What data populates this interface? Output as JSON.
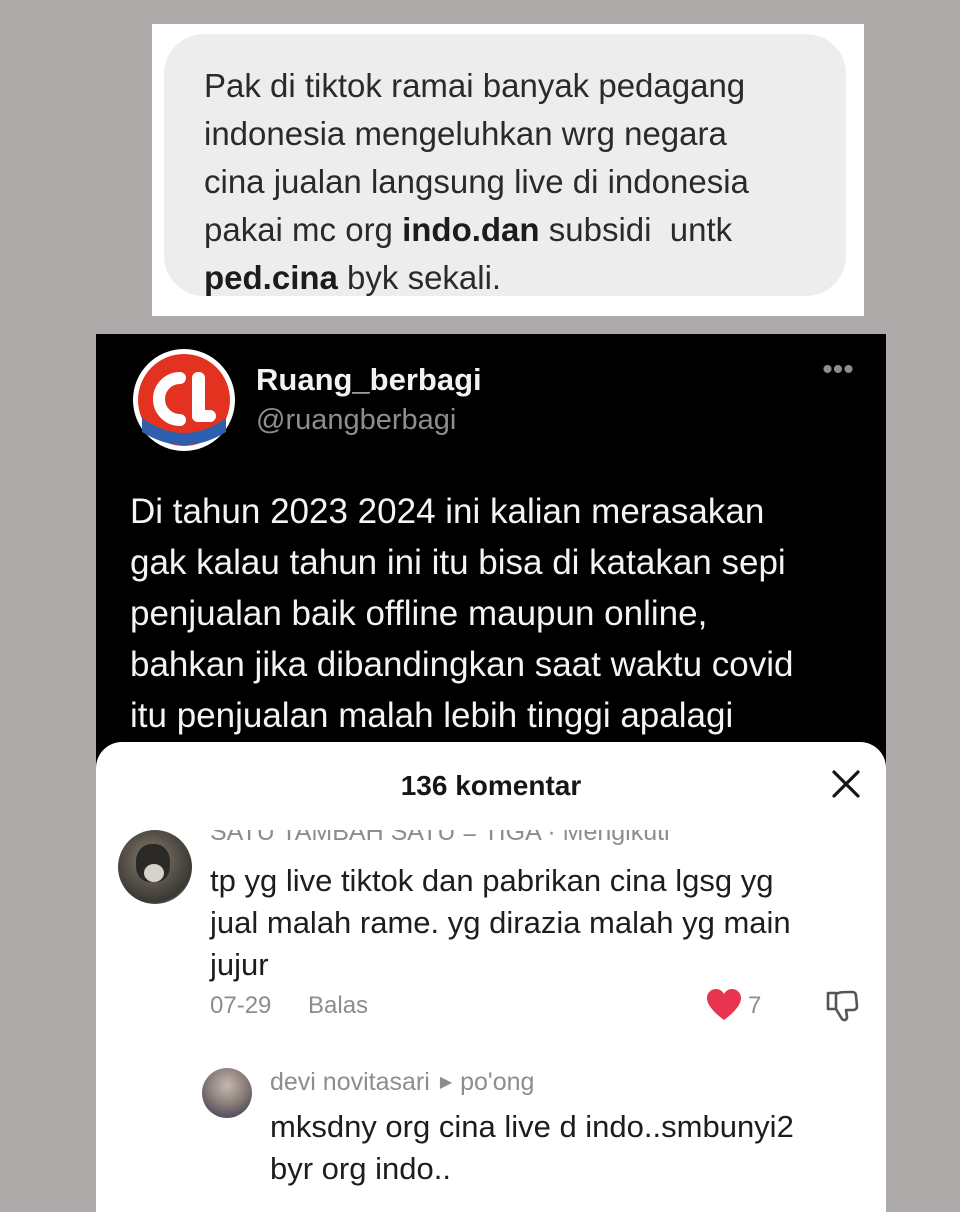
{
  "chat": {
    "line1": "Pak di tiktok ramai banyak pedagang",
    "line2": "indonesia mengeluhkan wrg negara",
    "line3": "cina jualan langsung live di indonesia",
    "line4_a": "pakai mc org ",
    "line4_b": "indo.dan",
    "line4_c": " subsidi  untk",
    "line5_a": "ped.cina",
    "line5_b": " byk sekali."
  },
  "tweet": {
    "name": "Ruang_berbagi",
    "handle": "@ruangberbagi",
    "more_icon": "more-dots-icon",
    "text_lines": [
      "Di tahun 2023 2024 ini kalian merasakan",
      "gak kalau tahun ini itu bisa di katakan sepi",
      "penjualan baik offline maupun online,",
      "bahkan jika dibandingkan saat waktu covid",
      "itu penjualan malah lebih tinggi apalagi"
    ]
  },
  "comments_sheet": {
    "title": "136 komentar",
    "close_icon": "close-icon",
    "comment": {
      "user": "SATU TAMBAH SATU = TIGA · Mengikuti",
      "text_lines": [
        "tp yg live tiktok dan pabrikan cina lgsg yg",
        "jual malah rame. yg dirazia malah yg main",
        "jujur"
      ],
      "date": "07-29",
      "reply_label": "Balas",
      "like_count": "7",
      "like_color": "#e8344e"
    },
    "reply": {
      "user": "devi novitasari",
      "reply_to": "po'ong",
      "text_lines": [
        "mksdny org cina live d indo..smbunyi2",
        "byr org indo.."
      ]
    }
  }
}
